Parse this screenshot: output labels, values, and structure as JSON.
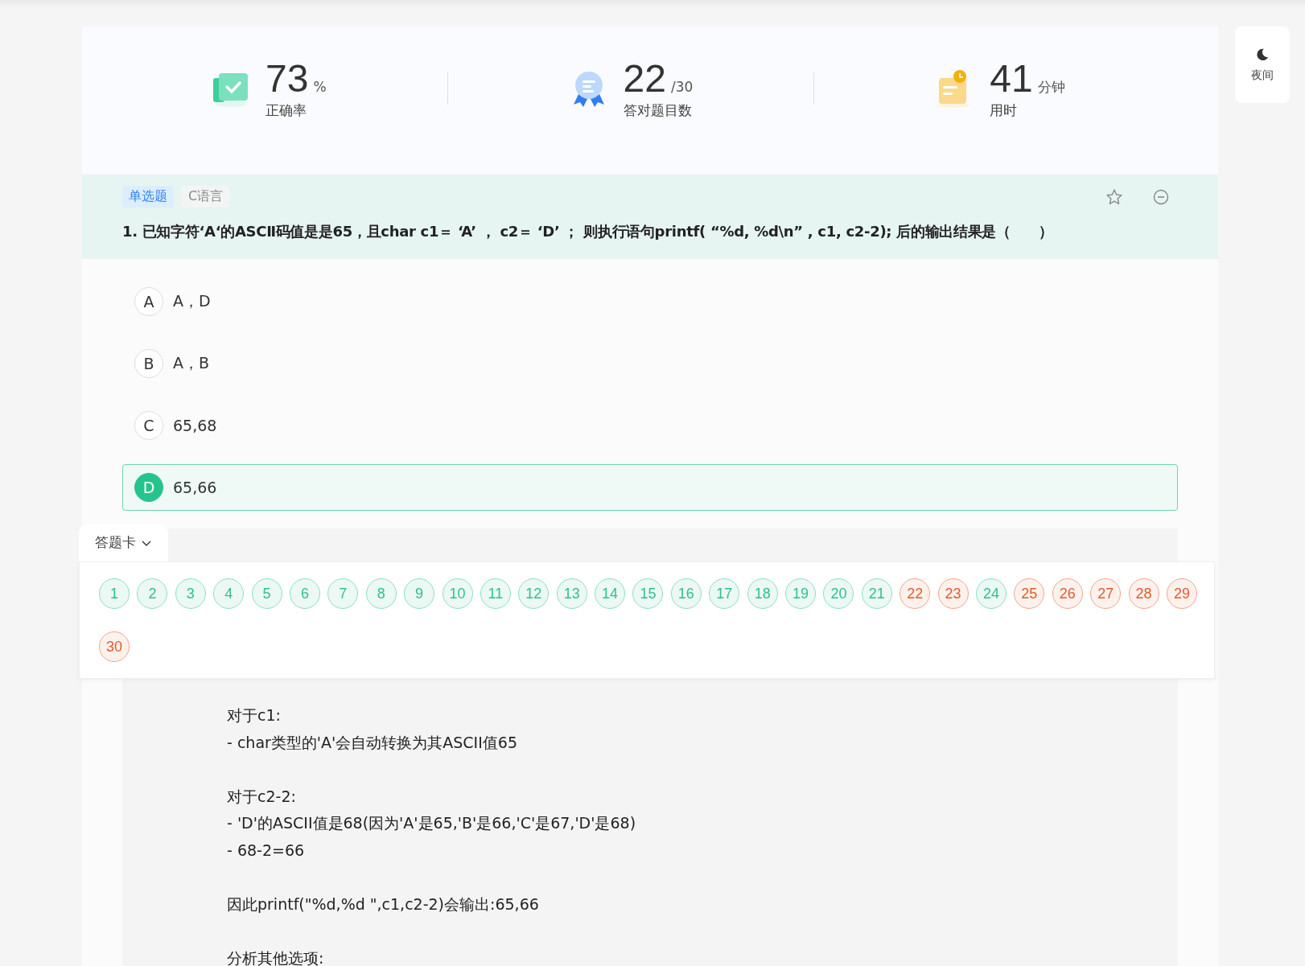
{
  "stats": [
    {
      "kind": "accuracy",
      "value": "73",
      "unit": "%",
      "label": "正确率"
    },
    {
      "kind": "correct",
      "value": "22",
      "unit": "/30",
      "label": "答对题目数"
    },
    {
      "kind": "time",
      "value": "41",
      "unit": "分钟",
      "label": "用时"
    }
  ],
  "night_button": {
    "label": "夜间"
  },
  "question": {
    "type_tag": "单选题",
    "subject_tag": "C语言",
    "text": "1. 已知字符‘A‘的ASCⅡ码值是是65，且char c1＝ ‘A’ ， c2＝ ‘D’ ； 则执行语句printf( “%d, %d\\n” , c1, c2-2); 后的输出结果是（　　）"
  },
  "options": [
    {
      "letter": "A",
      "text": "A，D",
      "selected": false
    },
    {
      "letter": "B",
      "text": "A，B",
      "selected": false
    },
    {
      "letter": "C",
      "text": "65,68",
      "selected": false
    },
    {
      "letter": "D",
      "text": "65,66",
      "selected": true
    }
  ],
  "answer_card": {
    "title": "答题卡",
    "expanded": true,
    "items": [
      {
        "number": "1",
        "correct": true
      },
      {
        "number": "2",
        "correct": true
      },
      {
        "number": "3",
        "correct": true
      },
      {
        "number": "4",
        "correct": true
      },
      {
        "number": "5",
        "correct": true
      },
      {
        "number": "6",
        "correct": true
      },
      {
        "number": "7",
        "correct": true
      },
      {
        "number": "8",
        "correct": true
      },
      {
        "number": "9",
        "correct": true
      },
      {
        "number": "10",
        "correct": true
      },
      {
        "number": "11",
        "correct": true
      },
      {
        "number": "12",
        "correct": true
      },
      {
        "number": "13",
        "correct": true
      },
      {
        "number": "14",
        "correct": true
      },
      {
        "number": "15",
        "correct": true
      },
      {
        "number": "16",
        "correct": true
      },
      {
        "number": "17",
        "correct": true
      },
      {
        "number": "18",
        "correct": true
      },
      {
        "number": "19",
        "correct": true
      },
      {
        "number": "20",
        "correct": true
      },
      {
        "number": "21",
        "correct": true
      },
      {
        "number": "22",
        "correct": false
      },
      {
        "number": "23",
        "correct": false
      },
      {
        "number": "24",
        "correct": true
      },
      {
        "number": "25",
        "correct": false
      },
      {
        "number": "26",
        "correct": false
      },
      {
        "number": "27",
        "correct": false
      },
      {
        "number": "28",
        "correct": false
      },
      {
        "number": "29",
        "correct": false
      },
      {
        "number": "30",
        "correct": false
      }
    ]
  },
  "explanation": [
    {
      "lines": [
        "对于c1:",
        "- char类型的'A'会自动转换为其ASCII值65"
      ]
    },
    {
      "lines": [
        "对于c2-2:",
        "- 'D'的ASCII值是68(因为'A'是65,'B'是66,'C'是67,'D'是68)",
        "- 68-2=66"
      ]
    },
    {
      "lines": [
        "因此printf(\"%d,%d \",c1,c2-2)会输出:65,66"
      ]
    },
    {
      "lines": [
        "分析其他选项:"
      ]
    }
  ]
}
